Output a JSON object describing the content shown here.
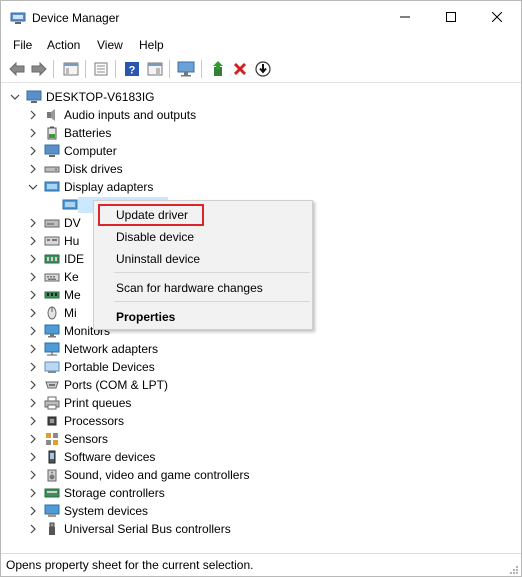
{
  "window": {
    "title": "Device Manager"
  },
  "menubar": [
    "File",
    "Action",
    "View",
    "Help"
  ],
  "toolbar": {
    "icons": [
      "back-icon",
      "forward-icon",
      "show-hide-console-tree-icon",
      "properties-icon",
      "help-icon",
      "show-action-pane-icon",
      "monitor-icon",
      "update-driver-icon",
      "uninstall-icon",
      "scan-hardware-icon"
    ]
  },
  "tree": {
    "root": "DESKTOP-V6183IG",
    "items": [
      {
        "label": "Audio inputs and outputs",
        "expanded": false
      },
      {
        "label": "Batteries",
        "expanded": false
      },
      {
        "label": "Computer",
        "expanded": false
      },
      {
        "label": "Disk drives",
        "expanded": false
      },
      {
        "label": "Display adapters",
        "expanded": true
      },
      {
        "label": "",
        "child": true
      },
      {
        "label": "DV",
        "expanded": false
      },
      {
        "label": "Hu",
        "expanded": false
      },
      {
        "label": "IDE",
        "expanded": false
      },
      {
        "label": "Ke",
        "expanded": false
      },
      {
        "label": "Me",
        "expanded": false
      },
      {
        "label": "Mi",
        "expanded": false
      },
      {
        "label": "Monitors",
        "expanded": false
      },
      {
        "label": "Network adapters",
        "expanded": false
      },
      {
        "label": "Portable Devices",
        "expanded": false
      },
      {
        "label": "Ports (COM & LPT)",
        "expanded": false
      },
      {
        "label": "Print queues",
        "expanded": false
      },
      {
        "label": "Processors",
        "expanded": false
      },
      {
        "label": "Sensors",
        "expanded": false
      },
      {
        "label": "Software devices",
        "expanded": false
      },
      {
        "label": "Sound, video and game controllers",
        "expanded": false
      },
      {
        "label": "Storage controllers",
        "expanded": false
      },
      {
        "label": "System devices",
        "expanded": false
      },
      {
        "label": "Universal Serial Bus controllers",
        "expanded": false
      }
    ]
  },
  "context_menu": {
    "update_driver": "Update driver",
    "disable_device": "Disable device",
    "uninstall_device": "Uninstall device",
    "scan_hardware": "Scan for hardware changes",
    "properties": "Properties"
  },
  "status": {
    "text": "Opens property sheet for the current selection."
  },
  "colors": {
    "highlight_border": "#d9252c",
    "menu_bg": "#f2f2f2"
  }
}
